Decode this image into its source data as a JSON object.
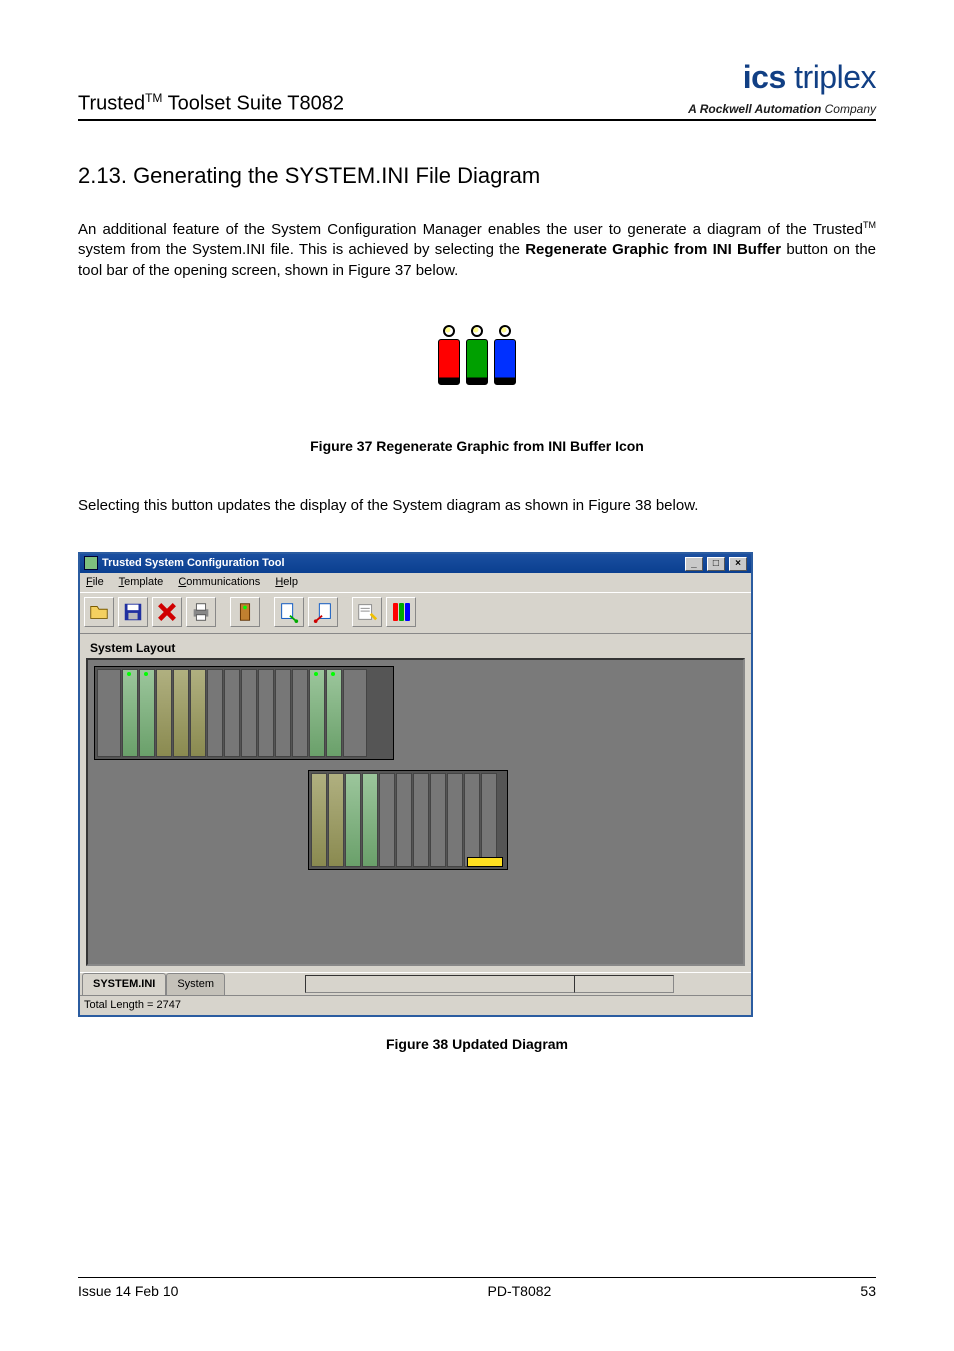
{
  "header": {
    "left_prefix": "Trusted",
    "left_tm": "TM",
    "left_suffix": " Toolset Suite T8082",
    "brand_bold": "ics",
    "brand_thin": " triplex",
    "brand_sub_bold": "A Rockwell Automation",
    "brand_sub_thin": " Company"
  },
  "section": {
    "number": "2.13.",
    "title": "Generating the SYSTEM.INI File Diagram"
  },
  "para1_a": "An additional feature of the System Configuration Manager enables the user to generate a diagram of the Trusted",
  "para1_tm": "TM",
  "para1_b": " system from the System.INI file.  This is achieved by selecting the ",
  "para1_bold": "Regenerate Graphic from INI Buffer",
  "para1_c": " button on the tool bar of the opening screen, shown in Figure 37 below.",
  "fig37": "Figure 37 Regenerate Graphic from INI Buffer Icon",
  "para2": "Selecting this button updates the display of the System diagram as shown in Figure 38 below.",
  "app": {
    "title": "Trusted System Configuration Tool",
    "menus": {
      "file": "File",
      "template": "Template",
      "communications": "Communications",
      "help": "Help"
    },
    "panel_label": "System Layout",
    "tab1": "SYSTEM.INI",
    "tab2": "System",
    "status": "Total Length = 2747"
  },
  "fig38": "Figure 38 Updated Diagram",
  "footer": {
    "left": "Issue 14 Feb 10",
    "center": "PD-T8082",
    "right": "53"
  }
}
